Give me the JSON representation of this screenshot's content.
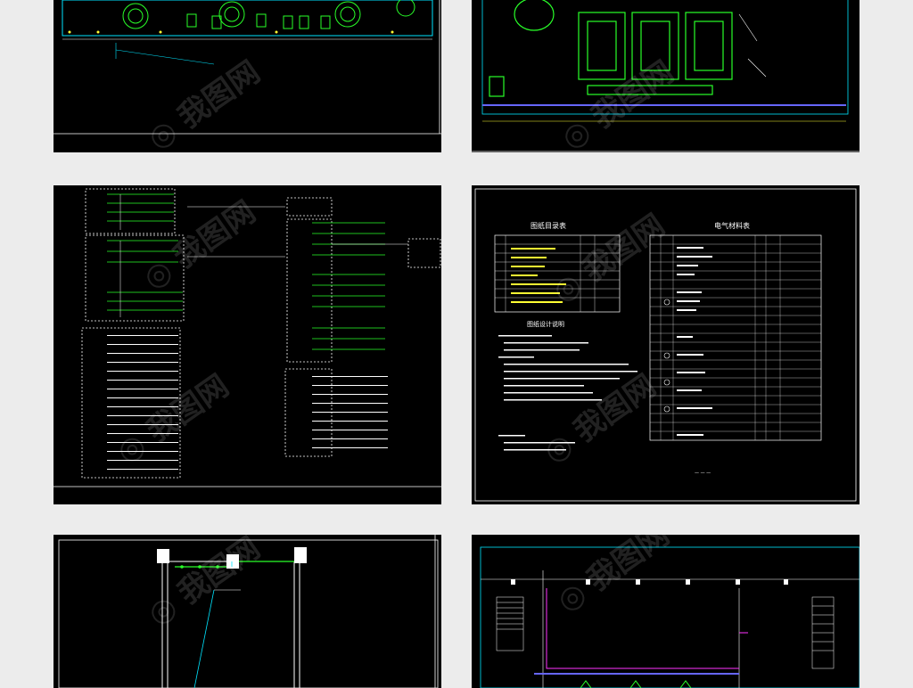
{
  "panels": [
    {
      "id": "floor-plan-lighting-top-left",
      "kind": "drawing"
    },
    {
      "id": "floor-plan-equipment-top-right",
      "kind": "drawing"
    },
    {
      "id": "distribution-system-diagram",
      "kind": "drawing"
    },
    {
      "id": "drawing-index-and-legend",
      "kind": "drawing"
    },
    {
      "id": "wiring-detail-bottom-left",
      "kind": "drawing"
    },
    {
      "id": "floor-plan-bottom-right",
      "kind": "drawing"
    }
  ],
  "sheet4": {
    "left_table_title": "图纸目录表",
    "right_table_title": "电气材料表",
    "notes_title": "图纸设计说明"
  },
  "colors": {
    "page_bg": "#ececec",
    "panel_bg": "#000000",
    "cyan": "#00e5ff",
    "green": "#29ff29",
    "white": "#ffffff",
    "yellow": "#ffff33",
    "magenta": "#ff33ff"
  },
  "watermark_logo_text": "我图网"
}
